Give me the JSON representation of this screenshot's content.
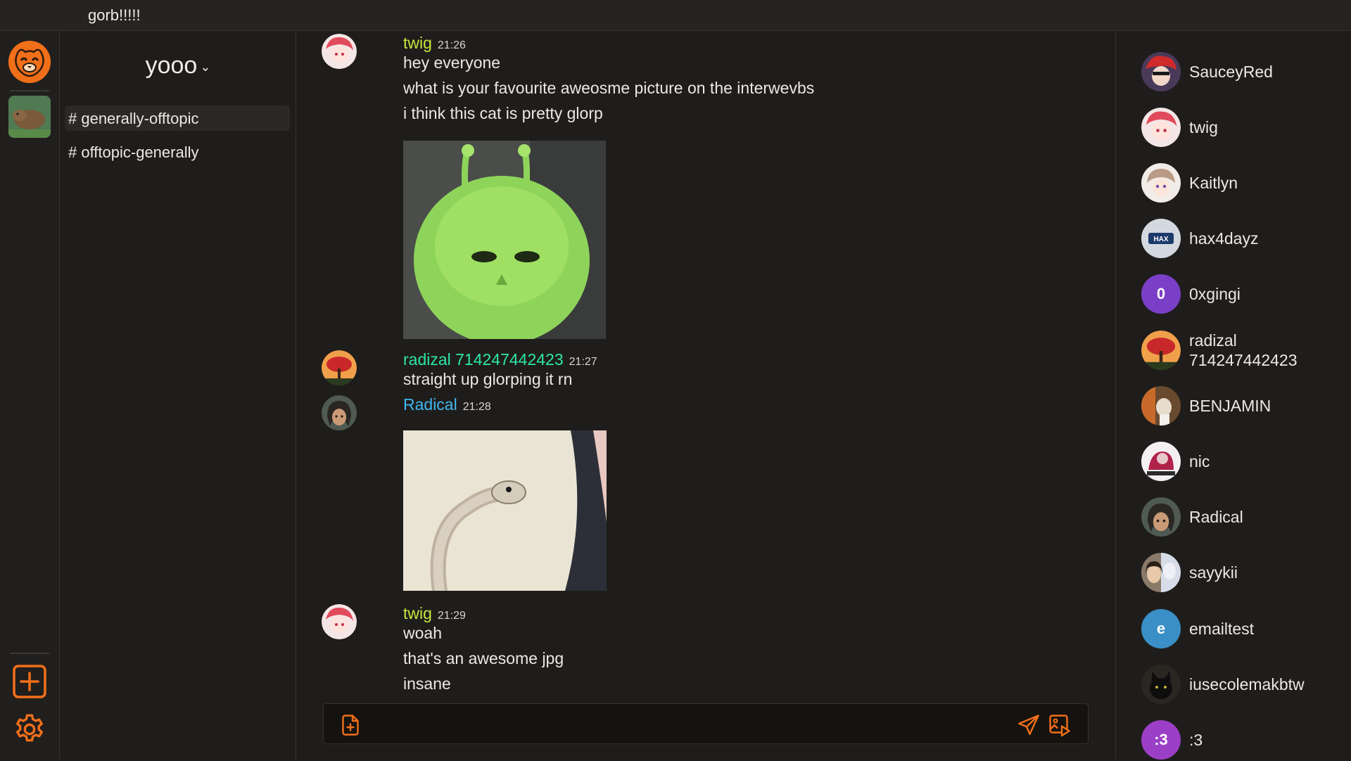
{
  "topbar": {
    "title": "gorb!!!!!"
  },
  "guild": {
    "name": "yooo",
    "chevron": "⌄"
  },
  "channels": [
    {
      "label": "# generally-offtopic",
      "active": true
    },
    {
      "label": "# offtopic-generally",
      "active": false
    }
  ],
  "messages": [
    {
      "user": "twig",
      "time": "21:26",
      "color": "#c8e63c",
      "lines": [
        "hey everyone",
        "what is your favourite aweosme picture on the interwevbs",
        "i think this cat is pretty glorp"
      ]
    },
    {
      "user": "radizal 714247442423",
      "time": "21:27",
      "color": "#2ee6a8",
      "lines": [
        "straight up glorping it rn"
      ]
    },
    {
      "user": "Radical",
      "time": "21:28",
      "color": "#3fb8f0",
      "lines": []
    },
    {
      "user": "twig",
      "time": "21:29",
      "color": "#c8e63c",
      "lines": [
        "woah",
        "that's an awesome jpg",
        "insane"
      ]
    }
  ],
  "composer": {
    "placeholder": ""
  },
  "members": [
    {
      "name": "SauceyRed"
    },
    {
      "name": "twig"
    },
    {
      "name": "Kaitlyn"
    },
    {
      "name": "hax4dayz",
      "avatar_text": "HAX"
    },
    {
      "name": "0xgingi",
      "avatar_text": "0",
      "avatar_color": "#7a3fc6"
    },
    {
      "name": "radizal 714247442423"
    },
    {
      "name": "BENJAMIN"
    },
    {
      "name": "nic"
    },
    {
      "name": "Radical"
    },
    {
      "name": "sayykii"
    },
    {
      "name": "emailtest",
      "avatar_text": "e",
      "avatar_color": "#3a8fc6"
    },
    {
      "name": "iusecolemakbtw"
    },
    {
      "name": ":3",
      "avatar_text": ":3",
      "avatar_color": "#9b3fc6"
    }
  ],
  "colors": {
    "accent": "#f26f1a",
    "background": "#1f1d1b",
    "topbar": "#262421"
  }
}
